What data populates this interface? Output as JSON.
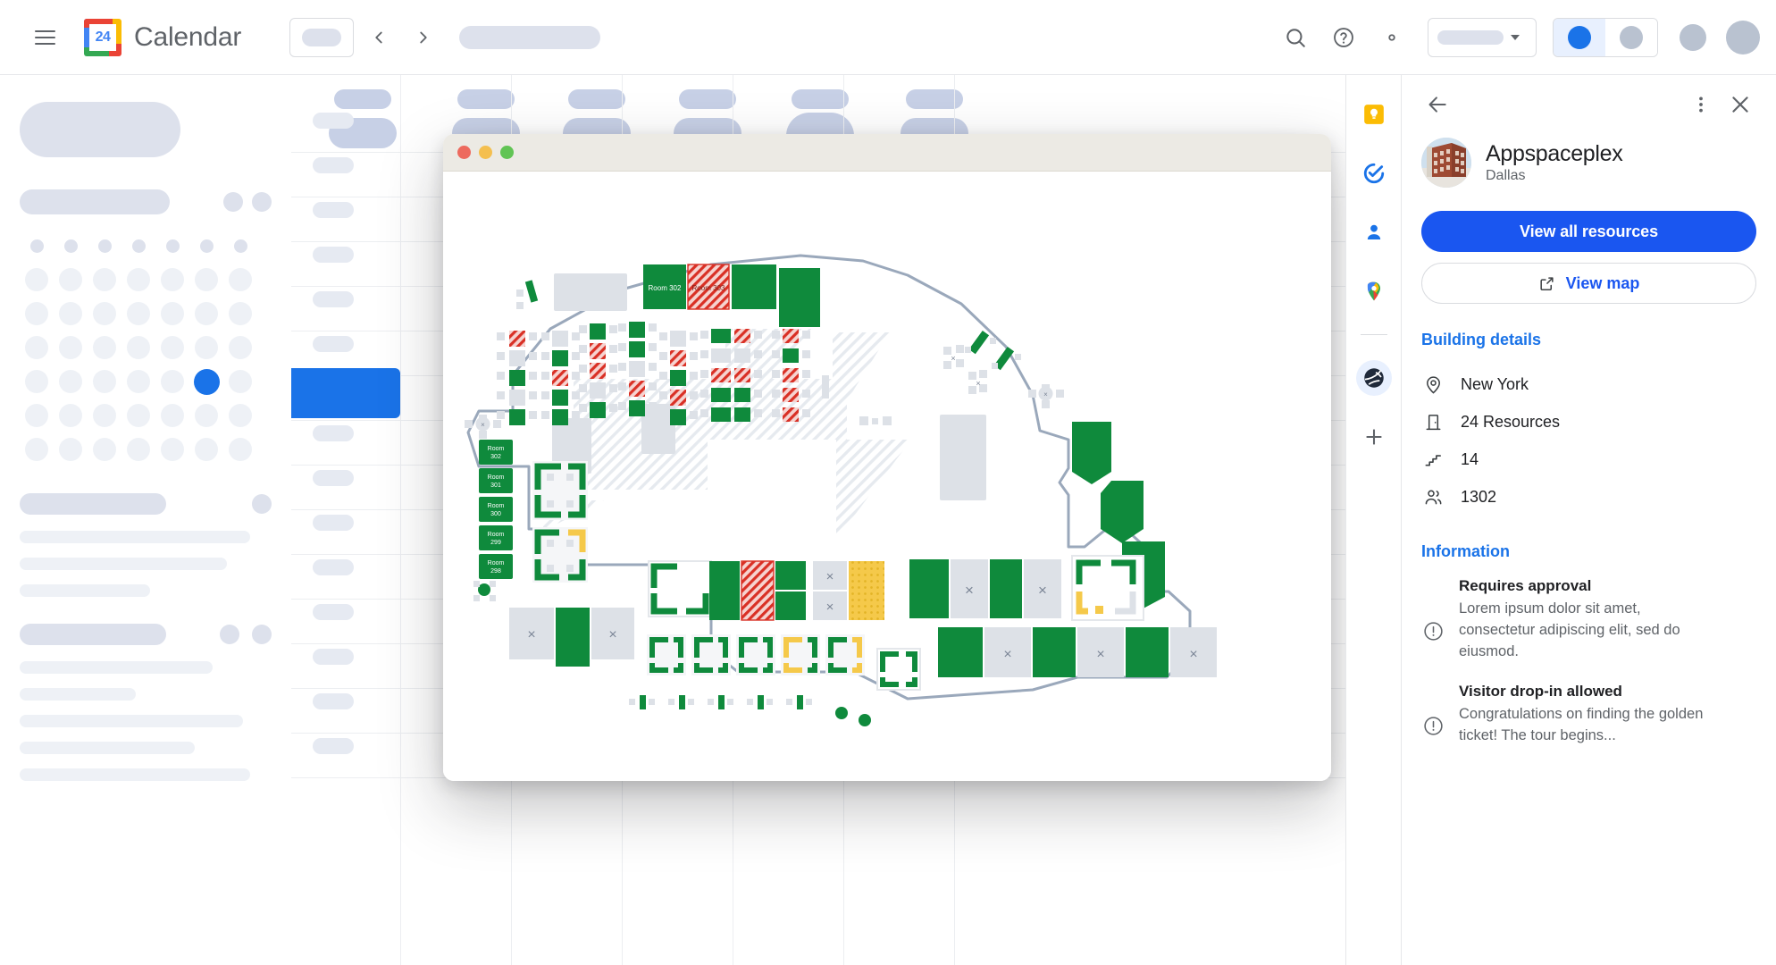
{
  "app": {
    "brand": "Calendar",
    "logo_number": "24"
  },
  "topbar": {
    "menu_icon": "hamburger-menu-icon",
    "today_label": "",
    "prev_icon": "chevron-left-icon",
    "next_icon": "chevron-right-icon",
    "search_icon": "search-icon",
    "help_icon": "help-icon",
    "settings_icon": "gear-icon",
    "view_select_value": "",
    "caret_icon": "chevron-down-icon",
    "toggle_left_icon": "calendar-view-toggle-icon",
    "toggle_right_icon": "list-view-toggle-icon",
    "apps_icon": "apps-grid-icon",
    "account_icon": "account-avatar"
  },
  "rail": {
    "items": [
      {
        "name": "google-keep-icon",
        "label": "Keep"
      },
      {
        "name": "google-tasks-icon",
        "label": "Tasks"
      },
      {
        "name": "google-contacts-icon",
        "label": "Contacts"
      },
      {
        "name": "google-maps-icon",
        "label": "Maps"
      },
      {
        "name": "workspace-booking-icon",
        "label": "Workspace booking"
      },
      {
        "name": "add-addon-icon",
        "label": "Get add-ons"
      }
    ]
  },
  "panel": {
    "back_icon": "back-arrow-icon",
    "more_icon": "more-options-icon",
    "close_icon": "close-icon",
    "building": {
      "name": "Appspaceplex",
      "city": "Dallas",
      "avatar_icon": "building-photo-avatar"
    },
    "actions": {
      "view_all_resources": "View all resources",
      "view_map": "View map",
      "view_map_icon": "open-in-new-icon"
    },
    "details": {
      "title": "Building details",
      "rows": [
        {
          "icon": "location-pin-icon",
          "value": "New York"
        },
        {
          "icon": "door-icon",
          "value": "24 Resources"
        },
        {
          "icon": "stairs-icon",
          "value": "14"
        },
        {
          "icon": "people-icon",
          "value": "1302"
        }
      ]
    },
    "information": {
      "title": "Information",
      "items": [
        {
          "icon": "info-exclamation-icon",
          "title": "Requires approval",
          "body": "Lorem ipsum dolor sit amet, consectetur adipiscing elit, sed do eiusmod."
        },
        {
          "icon": "info-exclamation-icon",
          "title": "Visitor drop-in allowed",
          "body": "Congratulations on finding the golden ticket! The tour begins..."
        }
      ]
    }
  },
  "floor_plan_window": {
    "titlebar": {
      "close_icon": "mac-close-button",
      "minimize_icon": "mac-minimize-button",
      "zoom_icon": "mac-zoom-button"
    },
    "rooms_top": [
      {
        "label": "Room 302",
        "status": "available"
      },
      {
        "label": "Room 303",
        "status": "booked"
      }
    ],
    "rooms_left": [
      {
        "label": "Room 302",
        "status": "available"
      },
      {
        "label": "Room 301",
        "status": "available"
      },
      {
        "label": "Room 300",
        "status": "available"
      },
      {
        "label": "Room 299",
        "status": "available"
      },
      {
        "label": "Room 298",
        "status": "available"
      }
    ],
    "legend_colors": {
      "available": "#0f8a3c",
      "booked": "#d93025",
      "unavailable": "#d8dce3",
      "highlight": "#f4c02c",
      "wall": "#9aa8bb"
    }
  },
  "colors": {
    "brand_blue": "#1a73e8",
    "primary_button": "#1a56f0",
    "link_blue": "#1a73e8",
    "text_primary": "#202124",
    "text_secondary": "#5f6368"
  }
}
